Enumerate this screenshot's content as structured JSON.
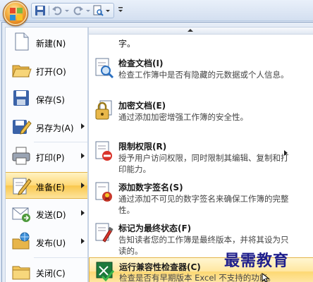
{
  "menu": {
    "left_items": [
      {
        "label": "新建(N)",
        "icon": "new-document-icon",
        "has_submenu": false
      },
      {
        "label": "打开(O)",
        "icon": "open-folder-icon",
        "has_submenu": false
      },
      {
        "label": "保存(S)",
        "icon": "save-disk-icon",
        "has_submenu": false
      },
      {
        "label": "另存为(A)",
        "icon": "save-as-icon",
        "has_submenu": true
      },
      {
        "label": "打印(P)",
        "icon": "printer-icon",
        "has_submenu": true
      },
      {
        "label": "准备(E)",
        "icon": "prepare-pencil-icon",
        "has_submenu": true,
        "active": true
      },
      {
        "label": "发送(D)",
        "icon": "send-icon",
        "has_submenu": true
      },
      {
        "label": "发布(U)",
        "icon": "publish-icon",
        "has_submenu": true
      },
      {
        "label": "关闭(C)",
        "icon": "close-folder-icon",
        "has_submenu": false
      }
    ]
  },
  "submenu": {
    "top_fragment": "字。",
    "items": [
      {
        "title": "检查文档(I)",
        "desc": "检查工作簿中是否有隐藏的元数据或个人信息。",
        "icon": "inspect-document-icon"
      },
      {
        "title": "加密文档(E)",
        "desc": "通过添加加密增强工作簿的安全性。",
        "icon": "encrypt-lock-icon"
      },
      {
        "title": "限制权限(R)",
        "desc": "授予用户访问权限，同时限制其编辑、复制和打印能力。",
        "icon": "restrict-permission-icon",
        "has_submenu": true
      },
      {
        "title": "添加数字签名(S)",
        "desc": "通过添加不可见的数字签名来确保工作簿的完整性。",
        "icon": "digital-signature-icon"
      },
      {
        "title": "标记为最终状态(F)",
        "desc": "告知读者您的工作簿是最终版本，并将其设为只读的。",
        "icon": "mark-final-icon"
      },
      {
        "title": "运行兼容性检查器(C)",
        "desc": "检查是否有早期版本 Excel 不支持的功能。",
        "icon": "compatibility-checker-icon",
        "hover": true
      }
    ]
  },
  "watermark": "最需教育",
  "colors": {
    "accent_active": "#f9c74c",
    "menu_bg": "#e5ecf6",
    "office_orange": "#e0801b"
  }
}
